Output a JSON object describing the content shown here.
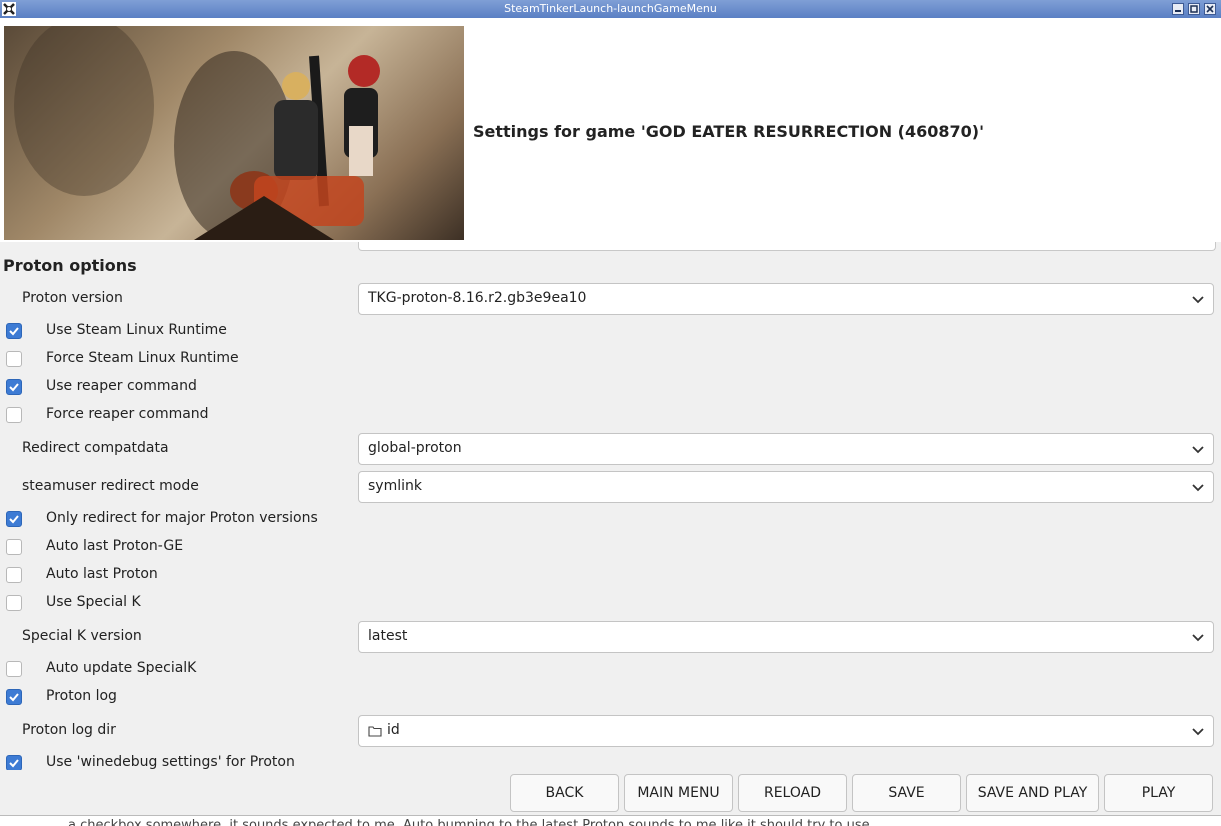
{
  "window": {
    "title": "SteamTinkerLaunch-launchGameMenu",
    "controls": [
      "minimize",
      "maximize",
      "close"
    ]
  },
  "header": {
    "game_title": "Settings for game 'GOD EATER RESURRECTION (460870)'"
  },
  "section": {
    "title": "Proton options"
  },
  "fields": {
    "proton_version": {
      "label": "Proton version",
      "value": "TKG-proton-8.16.r2.gb3e9ea10"
    },
    "use_steam_linux_runtime": {
      "label": "Use Steam Linux Runtime",
      "checked": true
    },
    "force_steam_linux_runtime": {
      "label": "Force Steam Linux Runtime",
      "checked": false
    },
    "use_reaper": {
      "label": "Use reaper command",
      "checked": true
    },
    "force_reaper": {
      "label": "Force reaper command",
      "checked": false
    },
    "redirect_compatdata": {
      "label": "Redirect compatdata",
      "value": "global-proton"
    },
    "steamuser_redirect": {
      "label": "steamuser redirect mode",
      "value": "symlink"
    },
    "only_redirect_major": {
      "label": "Only redirect for major Proton versions",
      "checked": true
    },
    "auto_last_proton_ge": {
      "label": "Auto last Proton-GE",
      "checked": false
    },
    "auto_last_proton": {
      "label": "Auto last Proton",
      "checked": false
    },
    "use_special_k": {
      "label": "Use Special K",
      "checked": false
    },
    "special_k_version": {
      "label": "Special K version",
      "value": "latest"
    },
    "auto_update_specialk": {
      "label": "Auto update SpecialK",
      "checked": false
    },
    "proton_log": {
      "label": "Proton log",
      "checked": true
    },
    "proton_log_dir": {
      "label": "Proton log dir",
      "value": "id"
    },
    "use_winedebug": {
      "label": "Use 'winedebug settings' for Proton",
      "checked": true
    }
  },
  "buttons": {
    "back": "BACK",
    "main_menu": "MAIN MENU",
    "reload": "RELOAD",
    "save": "SAVE",
    "save_and_play": "SAVE AND PLAY",
    "play": "PLAY"
  },
  "background_text": "a checkbox somewhere, it sounds expected to me. Auto bumping to the latest Proton sounds to me like it should try to use",
  "colors": {
    "titlebar": "#5a7fc4",
    "checkbox_on": "#3d7bd4"
  }
}
